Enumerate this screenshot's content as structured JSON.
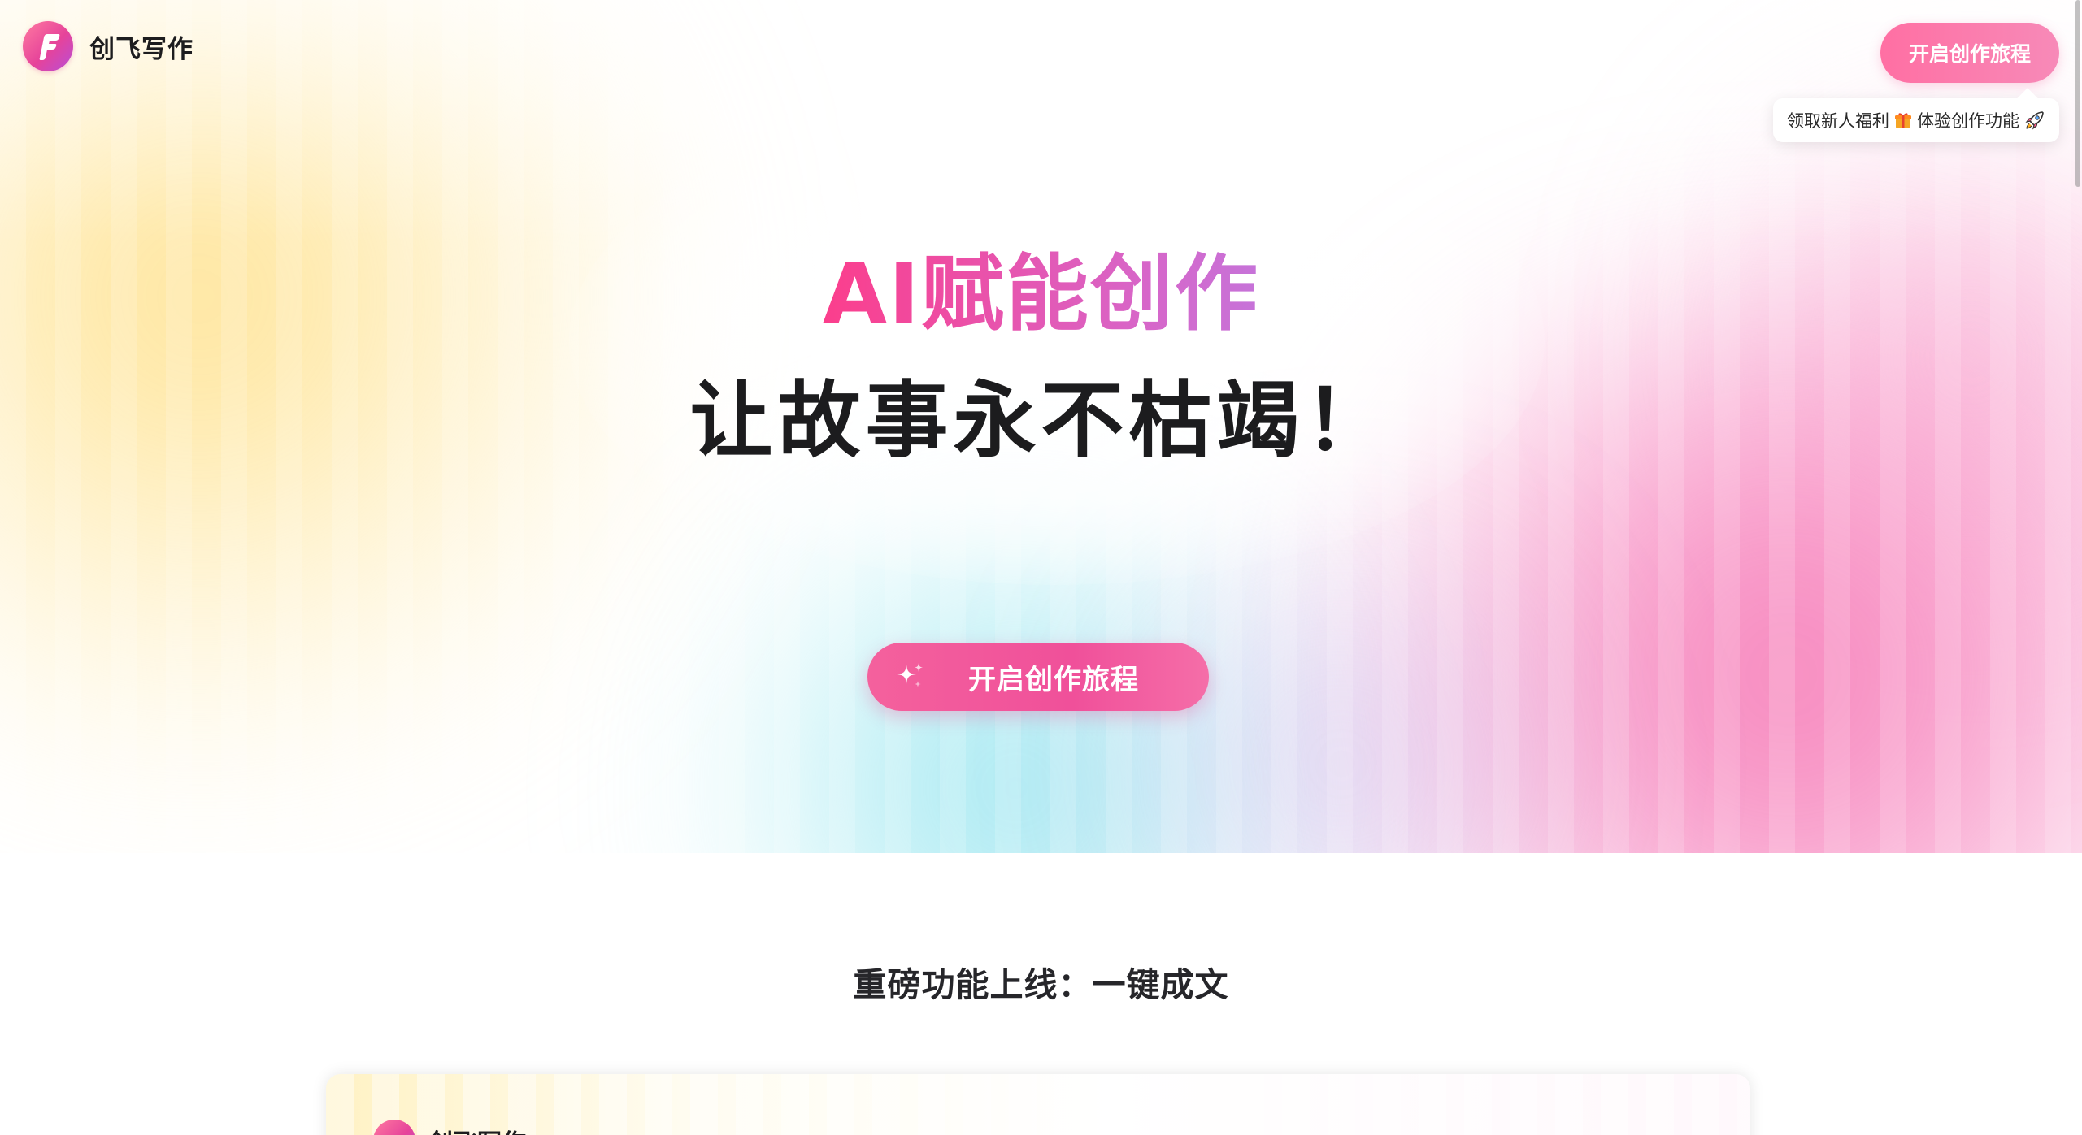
{
  "brand": {
    "name": "创飞写作",
    "logo_icon": "f-letter-logo-icon"
  },
  "header": {
    "cta_label": "开启创作旅程",
    "tooltip": {
      "text_before": "领取新人福利",
      "gift_icon": "gift-icon",
      "text_after": "体验创作功能",
      "rocket_icon": "rocket-icon"
    }
  },
  "hero": {
    "headline": "AI赋能创作",
    "subheadline": "让故事永不枯竭！",
    "cta_label": "开启创作旅程",
    "cta_icon": "sparkle-icon"
  },
  "feature_section": {
    "title": "重磅功能上线：一键成文",
    "preview": {
      "brand_name": "创飞写作"
    }
  },
  "colors": {
    "accent_pink": "#f0509a",
    "headline_gradient_start": "#ff3a86",
    "headline_gradient_end": "#b87ee6",
    "text_dark": "#1c1c1e"
  }
}
